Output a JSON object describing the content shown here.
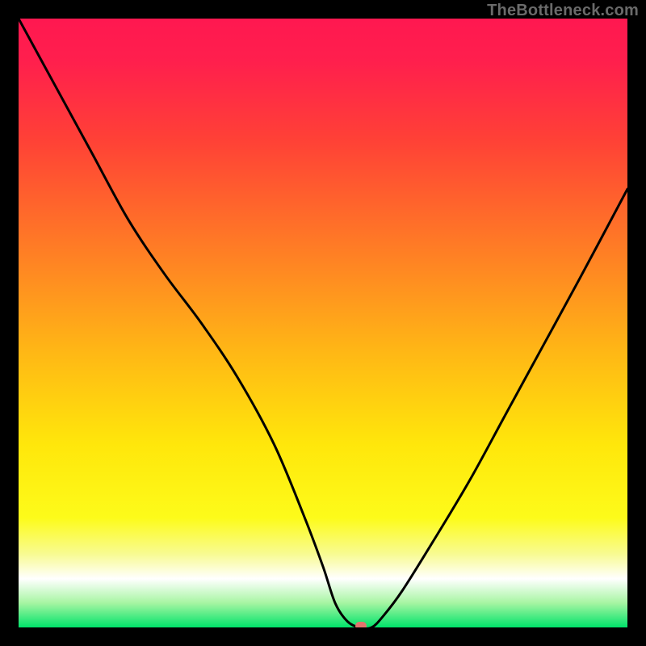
{
  "watermark": "TheBottleneck.com",
  "colors": {
    "gradient_stops": [
      {
        "offset": 0.0,
        "color": "#ff1850"
      },
      {
        "offset": 0.07,
        "color": "#ff1f4d"
      },
      {
        "offset": 0.2,
        "color": "#ff4136"
      },
      {
        "offset": 0.4,
        "color": "#ff8423"
      },
      {
        "offset": 0.55,
        "color": "#ffb815"
      },
      {
        "offset": 0.7,
        "color": "#ffe70b"
      },
      {
        "offset": 0.82,
        "color": "#fdfb1a"
      },
      {
        "offset": 0.88,
        "color": "#f8fb93"
      },
      {
        "offset": 0.92,
        "color": "#ffffff"
      },
      {
        "offset": 0.96,
        "color": "#a6f5a2"
      },
      {
        "offset": 1.0,
        "color": "#00e36a"
      }
    ],
    "curve": "#000000",
    "marker_fill": "#e2756e",
    "frame": "#000000"
  },
  "marker": {
    "x_pct": 56.2,
    "y_pct": 99.7,
    "w": 14,
    "h": 10,
    "rx": 7
  },
  "chart_data": {
    "type": "line",
    "title": "",
    "xlabel": "",
    "ylabel": "",
    "xlim": [
      0,
      100
    ],
    "ylim": [
      0,
      100
    ],
    "grid": false,
    "legend": false,
    "series": [
      {
        "name": "bottleneck-curve",
        "x": [
          0,
          6,
          12,
          18,
          24,
          30,
          36,
          42,
          47,
          50,
          52,
          54,
          56,
          58,
          60,
          63,
          68,
          74,
          80,
          86,
          92,
          100
        ],
        "y": [
          100,
          89,
          78,
          67,
          58,
          50,
          41,
          30,
          18,
          10,
          4,
          1,
          0,
          0,
          2,
          6,
          14,
          24,
          35,
          46,
          57,
          72
        ]
      }
    ],
    "marker_point": {
      "x": 56.2,
      "y": 0.3
    }
  }
}
